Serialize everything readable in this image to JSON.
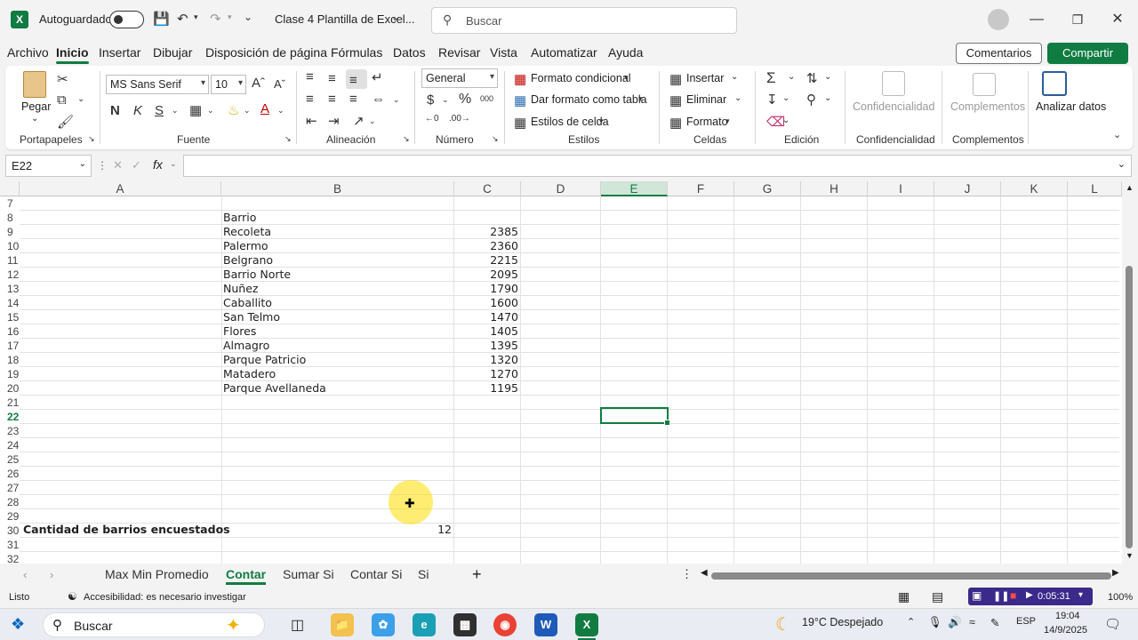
{
  "titlebar": {
    "autosave_label": "Autoguardado",
    "document_title": "Clase 4 Plantilla de Excel...",
    "search_placeholder": "Buscar"
  },
  "menu": {
    "tabs": [
      "Archivo",
      "Inicio",
      "Insertar",
      "Dibujar",
      "Disposición de página",
      "Fórmulas",
      "Datos",
      "Revisar",
      "Vista",
      "Automatizar",
      "Ayuda"
    ],
    "active": "Inicio",
    "comments_label": "Comentarios",
    "share_label": "Compartir"
  },
  "ribbon": {
    "paste_label": "Pegar",
    "font_name": "MS Sans Serif",
    "font_size": "10",
    "number_format": "General",
    "conditional_format": "Formato condicional",
    "format_as_table": "Dar formato como tabla",
    "cell_styles": "Estilos de celda",
    "insert": "Insertar",
    "delete": "Eliminar",
    "format": "Formato",
    "confidentiality": "Confidencialidad",
    "addins": "Complementos",
    "analyze_data": "Analizar datos",
    "groups": {
      "clipboard": "Portapapeles",
      "font": "Fuente",
      "alignment": "Alineación",
      "number": "Número",
      "styles": "Estilos",
      "cells": "Celdas",
      "editing": "Edición",
      "confidentiality": "Confidencialidad",
      "addins": "Complementos"
    }
  },
  "formula_bar": {
    "name_box": "E22",
    "fx": "fx",
    "content": ""
  },
  "sheet": {
    "columns": [
      "A",
      "B",
      "C",
      "D",
      "E",
      "F",
      "G",
      "H",
      "I",
      "J",
      "K",
      "L"
    ],
    "selected_column": "E",
    "rows": [
      "7",
      "8",
      "9",
      "10",
      "11",
      "12",
      "13",
      "14",
      "15",
      "16",
      "17",
      "18",
      "19",
      "20",
      "21",
      "22",
      "23",
      "24",
      "25",
      "26",
      "27",
      "28",
      "29",
      "30",
      "31",
      "32"
    ],
    "selected_row": "22",
    "header_b8": "Barrio",
    "barrios": [
      {
        "name": "Recoleta",
        "value": "2385"
      },
      {
        "name": "Palermo",
        "value": "2360"
      },
      {
        "name": "Belgrano",
        "value": "2215"
      },
      {
        "name": "Barrio Norte",
        "value": "2095"
      },
      {
        "name": "Nuñez",
        "value": "1790"
      },
      {
        "name": "Caballito",
        "value": "1600"
      },
      {
        "name": "San Telmo",
        "value": "1470"
      },
      {
        "name": "Flores",
        "value": "1405"
      },
      {
        "name": "Almagro",
        "value": "1395"
      },
      {
        "name": "Parque Patricio",
        "value": "1320"
      },
      {
        "name": "Matadero",
        "value": "1270"
      },
      {
        "name": "Parque Avellaneda",
        "value": "1195"
      }
    ],
    "count_label": "Cantidad de barrios encuestados",
    "count_value": "12"
  },
  "sheet_tabs": {
    "tabs": [
      "Max Min Promedio",
      "Contar",
      "Sumar Si",
      "Contar Si",
      "Si"
    ],
    "active": "Contar"
  },
  "statusbar": {
    "ready": "Listo",
    "accessibility": "Accesibilidad: es necesario investigar",
    "recording_time": "0:05:31",
    "zoom": "100%"
  },
  "taskbar": {
    "search_placeholder": "Buscar",
    "weather": "19°C  Despejado",
    "language": "ESP",
    "time": "19:04",
    "date": "14/9/2025"
  }
}
